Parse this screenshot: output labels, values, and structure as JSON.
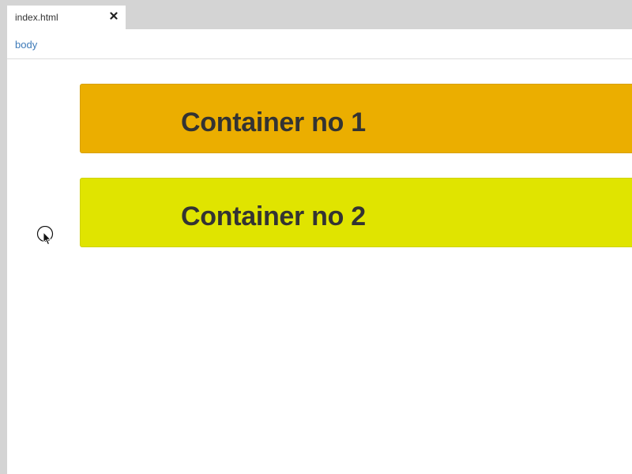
{
  "tab": {
    "label": "index.html",
    "close_icon": "close-icon"
  },
  "breadcrumb": {
    "items": [
      "body"
    ]
  },
  "containers": [
    {
      "label": "Container no 1",
      "color": "#ebae00"
    },
    {
      "label": "Container no 2",
      "color": "#e0e400"
    }
  ],
  "colors": {
    "chrome": "#d4d4d4",
    "tab_bg": "#ffffff",
    "breadcrumb_link": "#3d7ab8",
    "text": "#333333"
  }
}
